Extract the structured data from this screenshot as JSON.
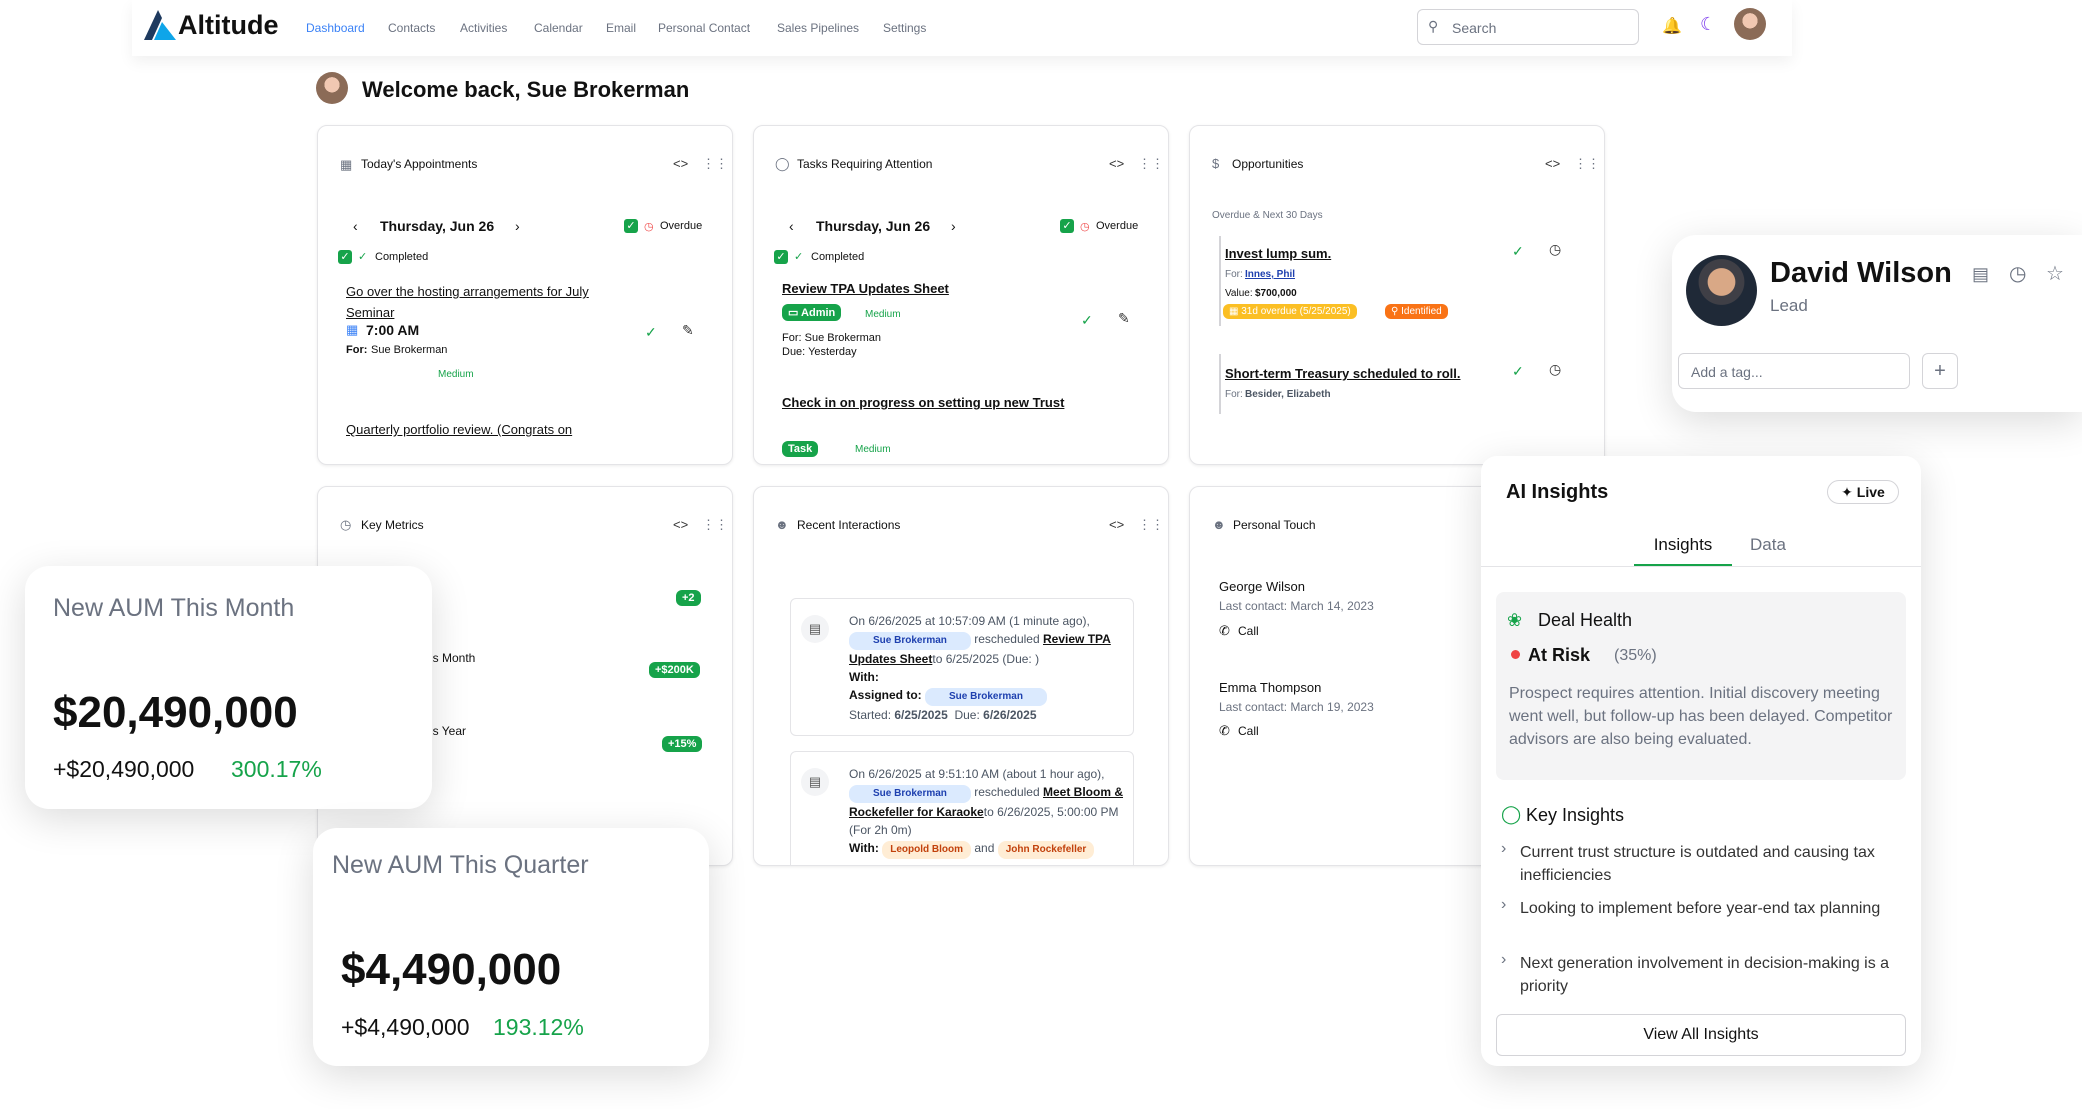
{
  "nav": {
    "brand": "Altitude",
    "items": [
      "Dashboard",
      "Contacts",
      "Activities",
      "Calendar",
      "Email",
      "Personal Contact",
      "Sales Pipelines",
      "Settings"
    ],
    "search_placeholder": "Search"
  },
  "welcome": "Welcome back, Sue Brokerman",
  "appointments": {
    "title": "Today's Appointments",
    "date": "Thursday, Jun 26",
    "overdue": "Overdue",
    "completed": "Completed",
    "item1_title": "Go over the hosting arrangements for July Seminar",
    "item1_time": "7:00 AM",
    "item1_for_label": "For:",
    "item1_for": "Sue Brokerman",
    "item1_priority": "Medium",
    "item2_title": "Quarterly portfolio review. (Congrats on"
  },
  "tasks": {
    "title": "Tasks Requiring Attention",
    "date": "Thursday, Jun 26",
    "overdue": "Overdue",
    "completed": "Completed",
    "t1_title": "Review TPA Updates Sheet",
    "t1_tag": "Admin",
    "t1_priority": "Medium",
    "t1_for": "For: Sue Brokerman",
    "t1_due": "Due: Yesterday",
    "t2_title": "Check in on progress on setting up new Trust",
    "t2_tag": "Task",
    "t2_priority": "Medium"
  },
  "opps": {
    "title": "Opportunities",
    "subtitle": "Overdue & Next 30 Days",
    "o1_title": "Invest lump sum.",
    "o1_for_label": "For:",
    "o1_for": "Innes, Phil",
    "o1_value_label": "Value:",
    "o1_value": "$700,000",
    "o1_overdue": "31d overdue (5/25/2025)",
    "o1_stage": "Identified",
    "o2_title": "Short-term Treasury scheduled to roll.",
    "o2_for_label": "For:",
    "o2_for": "Besider, Elizabeth"
  },
  "metrics": {
    "title": "Key Metrics",
    "b1": "+2",
    "label2": "is Month",
    "b2": "+$200K",
    "label3": "is Year",
    "b3": "+15%"
  },
  "interactions": {
    "title": "Recent Interactions",
    "i1_l1": "On 6/26/2025 at 10:57:09 AM (1 minute ago),",
    "i1_user": "Sue Brokerman",
    "i1_action": "rescheduled",
    "i1_link": "Review TPA Updates Sheet",
    "i1_to": "to 6/25/2025 (Due: )",
    "i1_with": "With:",
    "i1_assigned": "Assigned to:",
    "i1_started_label": "Started:",
    "i1_started": "6/25/2025",
    "i1_due_label": "Due:",
    "i1_due": "6/26/2025",
    "i2_l1": "On 6/26/2025 at 9:51:10 AM (about 1 hour ago),",
    "i2_user": "Sue Brokerman",
    "i2_action": "rescheduled",
    "i2_link": "Meet Bloom & Rockefeller for Karaoke",
    "i2_to": "to 6/26/2025, 5:00:00 PM (For 2h 0m)",
    "i2_with": "With:",
    "i2_p1": "Leopold Bloom",
    "i2_and": "and",
    "i2_p2": "John Rockefeller"
  },
  "personal": {
    "title": "Personal Touch",
    "p1_name": "George Wilson",
    "p1_last": "Last contact: March 14, 2023",
    "p1_call": "Call",
    "p2_name": "Emma Thompson",
    "p2_last": "Last contact: March 19, 2023",
    "p2_call": "Call"
  },
  "aum_month": {
    "label": "New AUM This Month",
    "value": "$20,490,000",
    "delta": "+$20,490,000",
    "pct": "300.17%"
  },
  "aum_quarter": {
    "label": "New AUM This Quarter",
    "value": "$4,490,000",
    "delta": "+$4,490,000",
    "pct": "193.12%"
  },
  "contact": {
    "name": "David Wilson",
    "role": "Lead",
    "tag_placeholder": "Add a tag...",
    "add": "+"
  },
  "ai": {
    "title": "AI Insights",
    "live": "Live",
    "tab1": "Insights",
    "tab2": "Data",
    "health_title": "Deal Health",
    "risk": "At Risk",
    "risk_pct": "(35%)",
    "desc": "Prospect requires attention. Initial discovery meeting went well, but follow-up has been delayed. Competitor advisors are also being evaluated.",
    "key_title": "Key Insights",
    "k1": "Current trust structure is outdated and causing tax inefficiencies",
    "k2": "Looking to implement before year-end tax planning",
    "k3": "Next generation involvement in decision-making is a priority",
    "view_all": "View All Insights"
  },
  "colors": {
    "accent": "#3b82f6",
    "success": "#16a34a",
    "danger": "#ef4444",
    "warning": "#f59e0b"
  }
}
